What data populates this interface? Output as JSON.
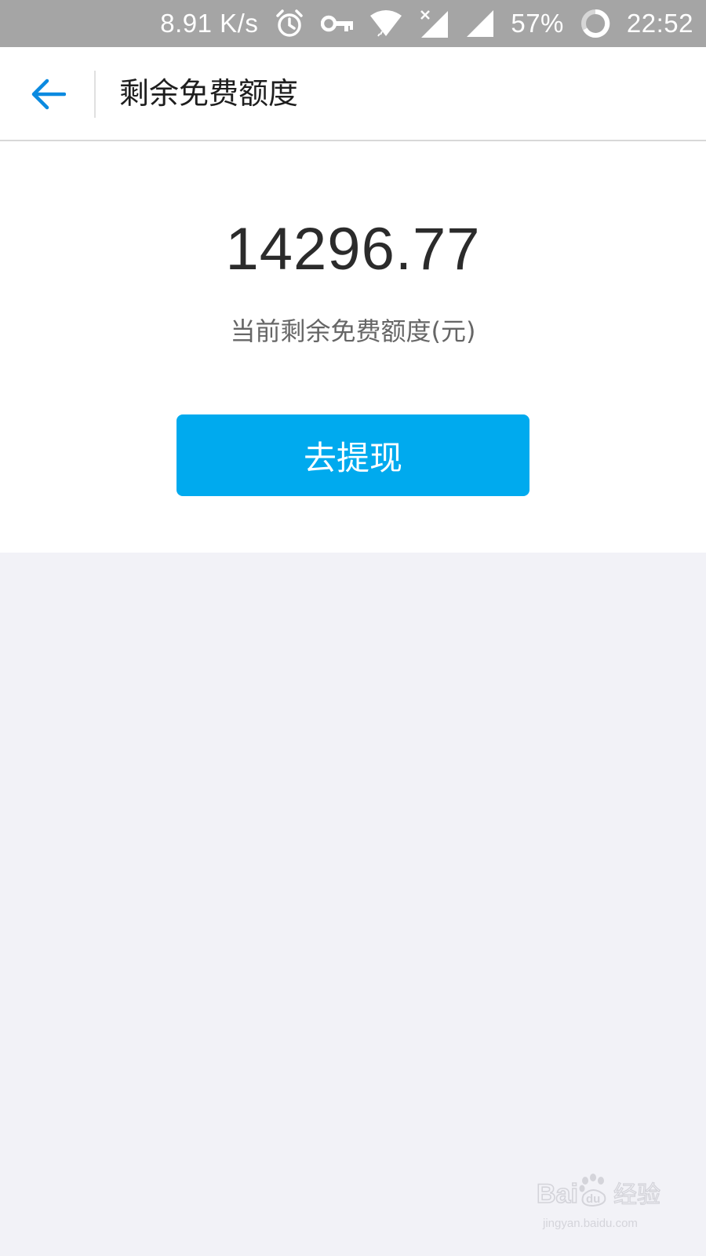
{
  "status_bar": {
    "net_speed": "8.91 K/s",
    "battery": "57%",
    "time": "22:52",
    "icons": [
      "alarm-icon",
      "vpn-key-icon",
      "wifi-icon",
      "signal-no-data-icon",
      "signal-icon",
      "battery-ring-icon"
    ]
  },
  "header": {
    "title": "剩余免费额度",
    "back_icon": "back-arrow-icon"
  },
  "balance": {
    "amount": "14296.77",
    "caption": "当前剩余免费额度(元)"
  },
  "actions": {
    "withdraw_label": "去提现"
  },
  "watermark": {
    "logo": "Baidu经验",
    "url": "jingyan.baidu.com"
  },
  "colors": {
    "status_bar": "#a5a5a5",
    "accent_blue": "#0b8ae0",
    "button": "#00aaee",
    "page_bg": "#f2f2f7"
  }
}
